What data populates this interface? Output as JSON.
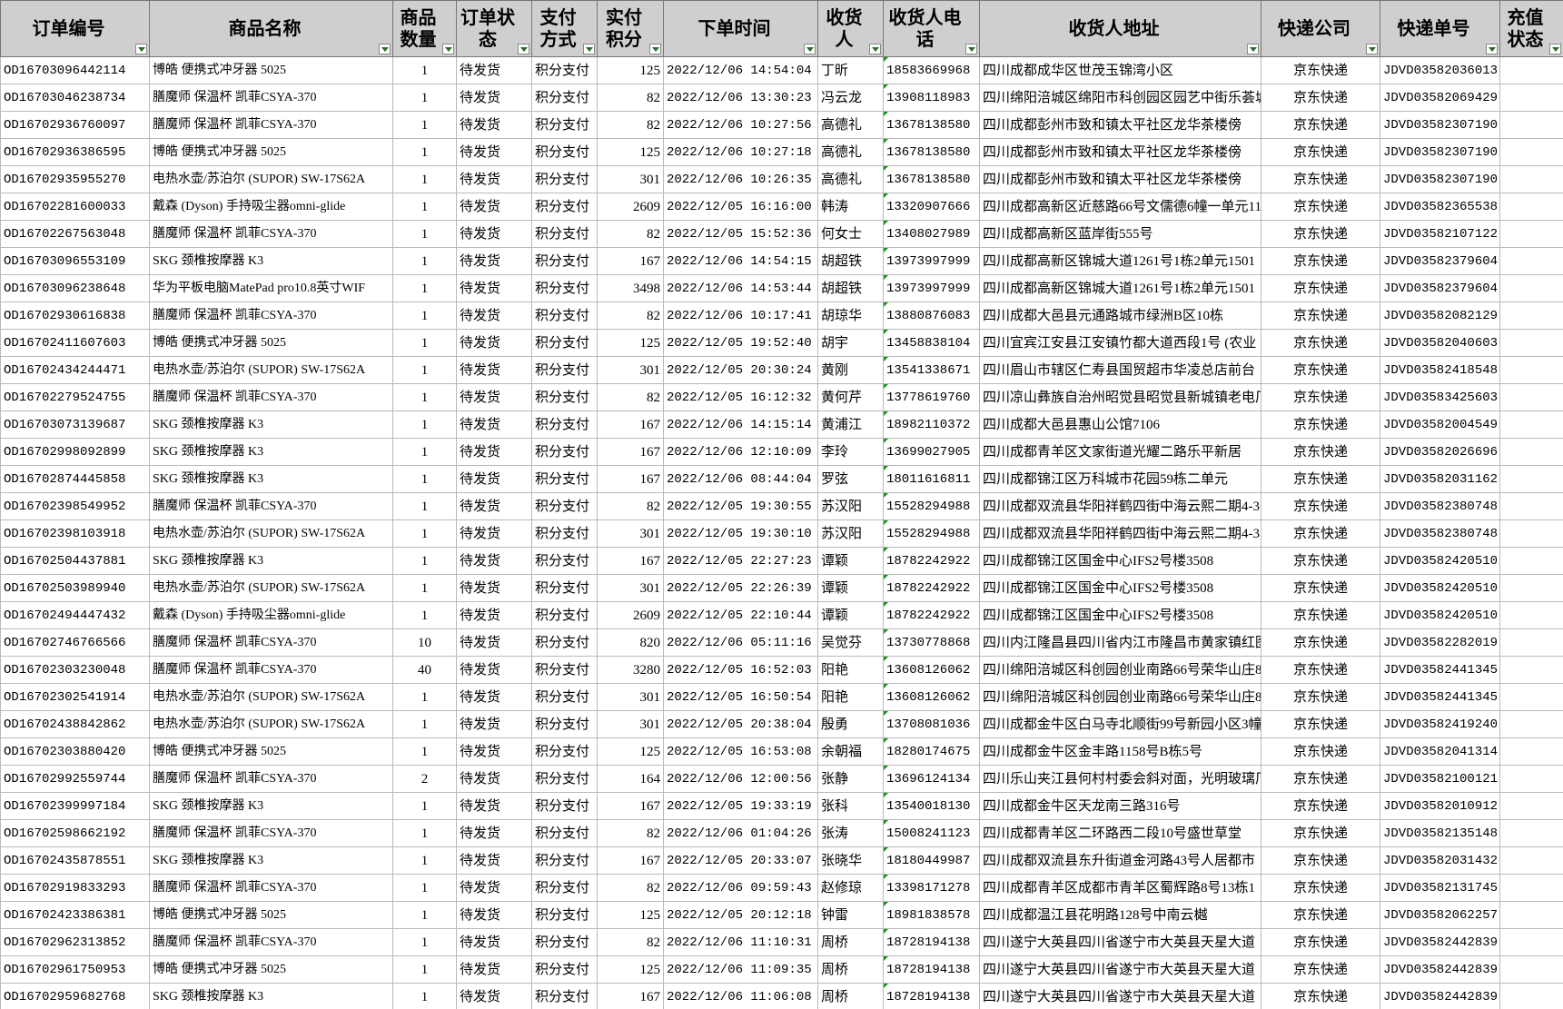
{
  "headers": [
    "订单编号",
    "商品名称",
    "商品数量",
    "订单状态",
    "支付方式",
    "实付积分",
    "下单时间",
    "收货人",
    "收货人电话",
    "收货人地址",
    "快递公司",
    "快递单号",
    "充值状态"
  ],
  "rows": [
    [
      "OD16703096442114",
      "博皓 便携式冲牙器 5025",
      "1",
      "待发货",
      "积分支付",
      "125",
      "2022/12/06 14:54:04",
      "丁昕",
      "18583669968",
      "四川成都成华区世茂玉锦湾小区",
      "京东快递",
      "JDVD03582036013",
      ""
    ],
    [
      "OD16703046238734",
      "膳魔师 保温杯 凯菲CSYA-370",
      "1",
      "待发货",
      "积分支付",
      "82",
      "2022/12/06 13:30:23",
      "冯云龙",
      "13908118983",
      "四川绵阳涪城区绵阳市科创园区园艺中街乐荟城",
      "京东快递",
      "JDVD03582069429",
      ""
    ],
    [
      "OD16702936760097",
      "膳魔师 保温杯 凯菲CSYA-370",
      "1",
      "待发货",
      "积分支付",
      "82",
      "2022/12/06 10:27:56",
      "高德礼",
      "13678138580",
      "四川成都彭州市致和镇太平社区龙华茶楼傍",
      "京东快递",
      "JDVD03582307190",
      ""
    ],
    [
      "OD16702936386595",
      "博皓 便携式冲牙器 5025",
      "1",
      "待发货",
      "积分支付",
      "125",
      "2022/12/06 10:27:18",
      "高德礼",
      "13678138580",
      "四川成都彭州市致和镇太平社区龙华茶楼傍",
      "京东快递",
      "JDVD03582307190",
      ""
    ],
    [
      "OD16702935955270",
      "电热水壶/苏泊尔 (SUPOR) SW-17S62A",
      "1",
      "待发货",
      "积分支付",
      "301",
      "2022/12/06 10:26:35",
      "高德礼",
      "13678138580",
      "四川成都彭州市致和镇太平社区龙华茶楼傍",
      "京东快递",
      "JDVD03582307190",
      ""
    ],
    [
      "OD16702281600033",
      "戴森 (Dyson) 手持吸尘器omni-glide",
      "1",
      "待发货",
      "积分支付",
      "2609",
      "2022/12/05 16:16:00",
      "韩涛",
      "13320907666",
      "四川成都高新区近慈路66号文儒德6幢一单元11",
      "京东快递",
      "JDVD03582365538",
      ""
    ],
    [
      "OD16702267563048",
      "膳魔师 保温杯 凯菲CSYA-370",
      "1",
      "待发货",
      "积分支付",
      "82",
      "2022/12/05 15:52:36",
      "何女士",
      "13408027989",
      "四川成都高新区蓝岸街555号",
      "京东快递",
      "JDVD03582107122",
      ""
    ],
    [
      "OD16703096553109",
      "SKG 颈椎按摩器 K3",
      "1",
      "待发货",
      "积分支付",
      "167",
      "2022/12/06 14:54:15",
      "胡超铁",
      "13973997999",
      "四川成都高新区锦城大道1261号1栋2单元1501",
      "京东快递",
      "JDVD03582379604",
      ""
    ],
    [
      "OD16703096238648",
      "华为平板电脑MatePad pro10.8英寸WIF",
      "1",
      "待发货",
      "积分支付",
      "3498",
      "2022/12/06 14:53:44",
      "胡超铁",
      "13973997999",
      "四川成都高新区锦城大道1261号1栋2单元1501",
      "京东快递",
      "JDVD03582379604",
      ""
    ],
    [
      "OD16702930616838",
      "膳魔师 保温杯 凯菲CSYA-370",
      "1",
      "待发货",
      "积分支付",
      "82",
      "2022/12/06 10:17:41",
      "胡琼华",
      "13880876083",
      "四川成都大邑县元通路城市绿洲B区10栋",
      "京东快递",
      "JDVD03582082129",
      ""
    ],
    [
      "OD16702411607603",
      "博皓 便携式冲牙器 5025",
      "1",
      "待发货",
      "积分支付",
      "125",
      "2022/12/05 19:52:40",
      "胡宇",
      "13458838104",
      "四川宜宾江安县江安镇竹都大道西段1号 (农业",
      "京东快递",
      "JDVD03582040603",
      ""
    ],
    [
      "OD16702434244471",
      "电热水壶/苏泊尔 (SUPOR) SW-17S62A",
      "1",
      "待发货",
      "积分支付",
      "301",
      "2022/12/05 20:30:24",
      "黄刚",
      "13541338671",
      "四川眉山市辖区仁寿县国贸超市华凌总店前台",
      "京东快递",
      "JDVD03582418548",
      ""
    ],
    [
      "OD16702279524755",
      "膳魔师 保温杯 凯菲CSYA-370",
      "1",
      "待发货",
      "积分支付",
      "82",
      "2022/12/05 16:12:32",
      "黄何芹",
      "13778619760",
      "四川凉山彝族自治州昭觉县昭觉县新城镇老电厂",
      "京东快递",
      "JDVD03583425603",
      ""
    ],
    [
      "OD16703073139687",
      "SKG 颈椎按摩器 K3",
      "1",
      "待发货",
      "积分支付",
      "167",
      "2022/12/06 14:15:14",
      "黄浦江",
      "18982110372",
      "四川成都大邑县惠山公馆7106",
      "京东快递",
      "JDVD03582004549",
      ""
    ],
    [
      "OD16702998092899",
      "SKG 颈椎按摩器 K3",
      "1",
      "待发货",
      "积分支付",
      "167",
      "2022/12/06 12:10:09",
      "李玲",
      "13699027905",
      "四川成都青羊区文家街道光耀二路乐平新居",
      "京东快递",
      "JDVD03582026696",
      ""
    ],
    [
      "OD16702874445858",
      "SKG 颈椎按摩器 K3",
      "1",
      "待发货",
      "积分支付",
      "167",
      "2022/12/06 08:44:04",
      "罗弦",
      "18011616811",
      "四川成都锦江区万科城市花园59栋二单元",
      "京东快递",
      "JDVD03582031162",
      ""
    ],
    [
      "OD16702398549952",
      "膳魔师 保温杯 凯菲CSYA-370",
      "1",
      "待发货",
      "积分支付",
      "82",
      "2022/12/05 19:30:55",
      "苏汉阳",
      "15528294988",
      "四川成都双流县华阳祥鹤四街中海云熙二期4-3",
      "京东快递",
      "JDVD03582380748",
      ""
    ],
    [
      "OD16702398103918",
      "电热水壶/苏泊尔 (SUPOR) SW-17S62A",
      "1",
      "待发货",
      "积分支付",
      "301",
      "2022/12/05 19:30:10",
      "苏汉阳",
      "15528294988",
      "四川成都双流县华阳祥鹤四街中海云熙二期4-3",
      "京东快递",
      "JDVD03582380748",
      ""
    ],
    [
      "OD16702504437881",
      "SKG 颈椎按摩器 K3",
      "1",
      "待发货",
      "积分支付",
      "167",
      "2022/12/05 22:27:23",
      "谭颖",
      "18782242922",
      "四川成都锦江区国金中心IFS2号楼3508",
      "京东快递",
      "JDVD03582420510",
      ""
    ],
    [
      "OD16702503989940",
      "电热水壶/苏泊尔 (SUPOR) SW-17S62A",
      "1",
      "待发货",
      "积分支付",
      "301",
      "2022/12/05 22:26:39",
      "谭颖",
      "18782242922",
      "四川成都锦江区国金中心IFS2号楼3508",
      "京东快递",
      "JDVD03582420510",
      ""
    ],
    [
      "OD16702494447432",
      "戴森 (Dyson) 手持吸尘器omni-glide",
      "1",
      "待发货",
      "积分支付",
      "2609",
      "2022/12/05 22:10:44",
      "谭颖",
      "18782242922",
      "四川成都锦江区国金中心IFS2号楼3508",
      "京东快递",
      "JDVD03582420510",
      ""
    ],
    [
      "OD16702746766566",
      "膳魔师 保温杯 凯菲CSYA-370",
      "10",
      "待发货",
      "积分支付",
      "820",
      "2022/12/06 05:11:16",
      "吴觉芬",
      "13730778868",
      "四川内江隆昌县四川省内江市隆昌市黄家镇红图",
      "京东快递",
      "JDVD03582282019",
      ""
    ],
    [
      "OD16702303230048",
      "膳魔师 保温杯 凯菲CSYA-370",
      "40",
      "待发货",
      "积分支付",
      "3280",
      "2022/12/05 16:52:03",
      "阳艳",
      "13608126062",
      "四川绵阳涪城区科创园创业南路66号荣华山庄8",
      "京东快递",
      "JDVD03582441345",
      ""
    ],
    [
      "OD16702302541914",
      "电热水壶/苏泊尔 (SUPOR) SW-17S62A",
      "1",
      "待发货",
      "积分支付",
      "301",
      "2022/12/05 16:50:54",
      "阳艳",
      "13608126062",
      "四川绵阳涪城区科创园创业南路66号荣华山庄8",
      "京东快递",
      "JDVD03582441345",
      ""
    ],
    [
      "OD16702438842862",
      "电热水壶/苏泊尔 (SUPOR) SW-17S62A",
      "1",
      "待发货",
      "积分支付",
      "301",
      "2022/12/05 20:38:04",
      "殷勇",
      "13708081036",
      "四川成都金牛区白马寺北顺街99号新园小区3幢",
      "京东快递",
      "JDVD03582419240",
      ""
    ],
    [
      "OD16702303880420",
      "博皓 便携式冲牙器 5025",
      "1",
      "待发货",
      "积分支付",
      "125",
      "2022/12/05 16:53:08",
      "余朝福",
      "18280174675",
      "四川成都金牛区金丰路1158号B栋5号",
      "京东快递",
      "JDVD03582041314",
      ""
    ],
    [
      "OD16702992559744",
      "膳魔师 保温杯 凯菲CSYA-370",
      "2",
      "待发货",
      "积分支付",
      "164",
      "2022/12/06 12:00:56",
      "张静",
      "13696124134",
      "四川乐山夹江县何村村委会斜对面，光明玻璃厂",
      "京东快递",
      "JDVD03582100121",
      ""
    ],
    [
      "OD16702399997184",
      "SKG 颈椎按摩器 K3",
      "1",
      "待发货",
      "积分支付",
      "167",
      "2022/12/05 19:33:19",
      "张科",
      "13540018130",
      "四川成都金牛区天龙南三路316号",
      "京东快递",
      "JDVD03582010912",
      ""
    ],
    [
      "OD16702598662192",
      "膳魔师 保温杯 凯菲CSYA-370",
      "1",
      "待发货",
      "积分支付",
      "82",
      "2022/12/06 01:04:26",
      "张涛",
      "15008241123",
      "四川成都青羊区二环路西二段10号盛世草堂",
      "京东快递",
      "JDVD03582135148",
      ""
    ],
    [
      "OD16702435878551",
      "SKG 颈椎按摩器 K3",
      "1",
      "待发货",
      "积分支付",
      "167",
      "2022/12/05 20:33:07",
      "张晓华",
      "18180449987",
      "四川成都双流县东升街道金河路43号人居都市",
      "京东快递",
      "JDVD03582031432",
      ""
    ],
    [
      "OD16702919833293",
      "膳魔师 保温杯 凯菲CSYA-370",
      "1",
      "待发货",
      "积分支付",
      "82",
      "2022/12/06 09:59:43",
      "赵修琼",
      "13398171278",
      "四川成都青羊区成都市青羊区蜀辉路8号13栋1",
      "京东快递",
      "JDVD03582131745",
      ""
    ],
    [
      "OD16702423386381",
      "博皓 便携式冲牙器 5025",
      "1",
      "待发货",
      "积分支付",
      "125",
      "2022/12/05 20:12:18",
      "钟雷",
      "18981838578",
      "四川成都温江县花明路128号中南云樾",
      "京东快递",
      "JDVD03582062257",
      ""
    ],
    [
      "OD16702962313852",
      "膳魔师 保温杯 凯菲CSYA-370",
      "1",
      "待发货",
      "积分支付",
      "82",
      "2022/12/06 11:10:31",
      "周桥",
      "18728194138",
      "四川遂宁大英县四川省遂宁市大英县天星大道",
      "京东快递",
      "JDVD03582442839",
      ""
    ],
    [
      "OD16702961750953",
      "博皓 便携式冲牙器 5025",
      "1",
      "待发货",
      "积分支付",
      "125",
      "2022/12/06 11:09:35",
      "周桥",
      "18728194138",
      "四川遂宁大英县四川省遂宁市大英县天星大道",
      "京东快递",
      "JDVD03582442839",
      ""
    ],
    [
      "OD16702959682768",
      "SKG 颈椎按摩器 K3",
      "1",
      "待发货",
      "积分支付",
      "167",
      "2022/12/06 11:06:08",
      "周桥",
      "18728194138",
      "四川遂宁大英县四川省遂宁市大英县天星大道",
      "京东快递",
      "JDVD03582442839",
      ""
    ]
  ]
}
